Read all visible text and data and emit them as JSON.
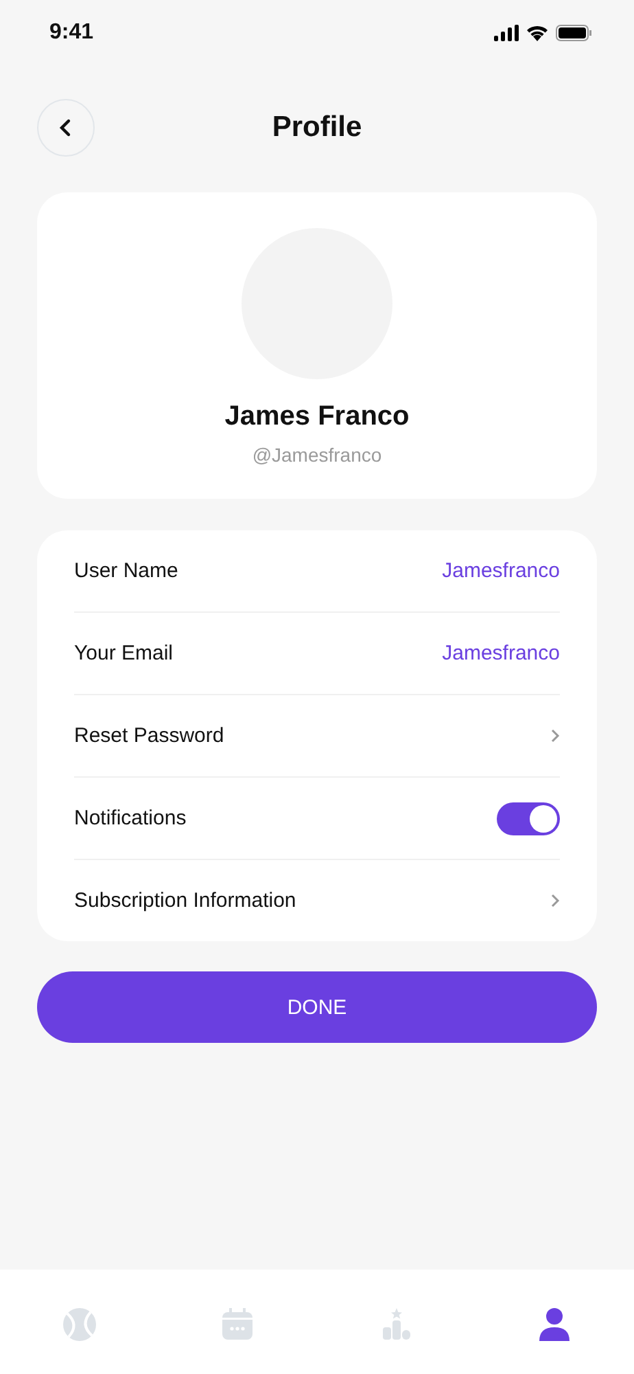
{
  "status_bar": {
    "time": "9:41"
  },
  "header": {
    "title": "Profile"
  },
  "profile": {
    "name": "James Franco",
    "handle": "@Jamesfranco"
  },
  "settings": [
    {
      "kind": "value",
      "label": "User Name",
      "value": "Jamesfranco"
    },
    {
      "kind": "value",
      "label": "Your Email",
      "value": "Jamesfranco"
    },
    {
      "kind": "link",
      "label": "Reset Password"
    },
    {
      "kind": "toggle",
      "label": "Notifications",
      "on": true
    },
    {
      "kind": "link",
      "label": "Subscription Information"
    }
  ],
  "done_button": {
    "label": "DONE"
  },
  "nav": [
    {
      "kind": "ball",
      "selected": false
    },
    {
      "kind": "calendar",
      "selected": false
    },
    {
      "kind": "podium",
      "selected": false
    },
    {
      "kind": "person",
      "selected": true
    }
  ]
}
